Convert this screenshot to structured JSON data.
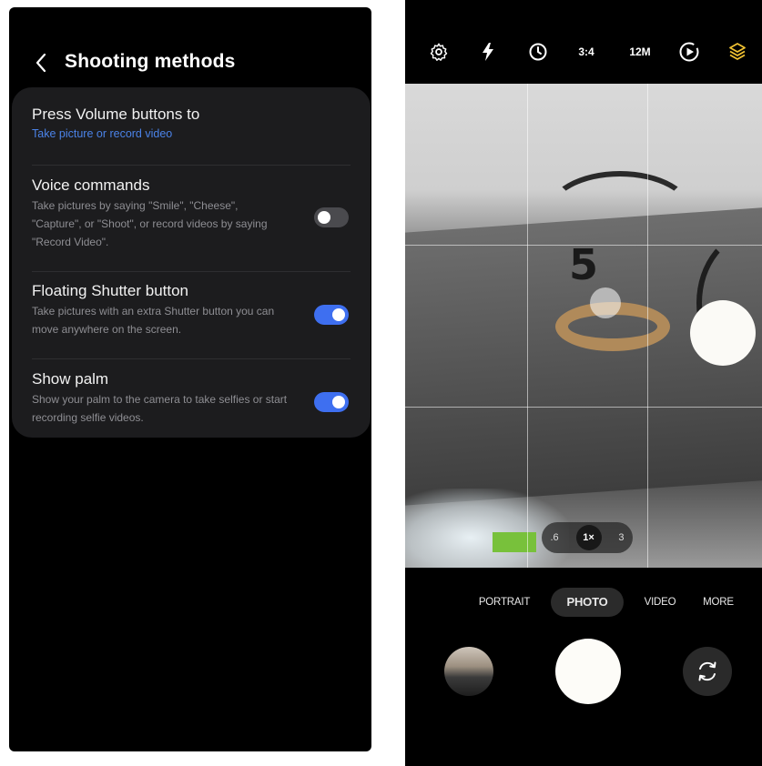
{
  "settings": {
    "title": "Shooting methods",
    "rows": [
      {
        "title": "Press Volume buttons to",
        "value": "Take picture or record video"
      },
      {
        "title": "Voice commands",
        "subtitle": "Take pictures by saying \"Smile\", \"Cheese\", \"Capture\", or \"Shoot\", or record videos by saying \"Record Video\".",
        "toggle": "off"
      },
      {
        "title": "Floating Shutter button",
        "subtitle": "Take pictures with an extra Shutter button you can move anywhere on the screen.",
        "toggle": "on"
      },
      {
        "title": "Show palm",
        "subtitle": "Show your palm to the camera to take selfies or start recording selfie videos.",
        "toggle": "on"
      }
    ],
    "colors": {
      "accent": "#3e6ff0",
      "link": "#4b83e8"
    }
  },
  "camera": {
    "topbar": {
      "icons": [
        "settings-gear-icon",
        "flash-icon",
        "timer-icon",
        "aspect-ratio",
        "resolution",
        "motion-photo-icon",
        "filters-icon"
      ],
      "aspect": "3:4",
      "resolution": "12M",
      "filter_color": "#f1c232"
    },
    "zoom": {
      "left": ".6",
      "selected": "1×",
      "right": "3"
    },
    "modes": [
      "PORTRAIT",
      "PHOTO",
      "VIDEO",
      "MORE"
    ],
    "active_mode": "PHOTO"
  }
}
